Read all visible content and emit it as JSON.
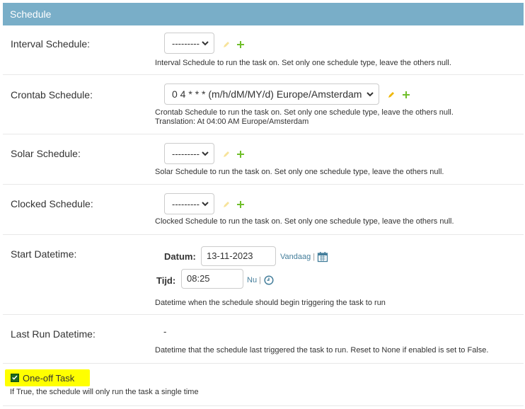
{
  "header": {
    "title": "Schedule"
  },
  "interval": {
    "label": "Interval Schedule:",
    "value": "---------",
    "help": "Interval Schedule to run the task on. Set only one schedule type, leave the others null."
  },
  "crontab": {
    "label": "Crontab Schedule:",
    "value": "0 4 * * * (m/h/dM/MY/d) Europe/Amsterdam",
    "help": "Crontab Schedule to run the task on. Set only one schedule type, leave the others null.",
    "translation": "Translation: At 04:00 AM Europe/Amsterdam"
  },
  "solar": {
    "label": "Solar Schedule:",
    "value": "---------",
    "help": "Solar Schedule to run the task on. Set only one schedule type, leave the others null."
  },
  "clocked": {
    "label": "Clocked Schedule:",
    "value": "---------",
    "help": "Clocked Schedule to run the task on. Set only one schedule type, leave the others null."
  },
  "start": {
    "label": "Start Datetime:",
    "date_label": "Datum:",
    "date_value": "13-11-2023",
    "today_link": "Vandaag",
    "time_label": "Tijd:",
    "time_value": "08:25",
    "now_link": "Nu",
    "help": "Datetime when the schedule should begin triggering the task to run"
  },
  "last_run": {
    "label": "Last Run Datetime:",
    "value": "-",
    "help": "Datetime that the schedule last triggered the task to run. Reset to None if enabled is set to False."
  },
  "one_off": {
    "label": "One-off Task",
    "checked": true,
    "help": "If True, the schedule will only run the task a single time"
  },
  "colors": {
    "header": "#79aec8",
    "link": "#447e9b",
    "plus": "#70bf2b",
    "pencil": "#efb80b",
    "highlight": "#ffff00"
  }
}
